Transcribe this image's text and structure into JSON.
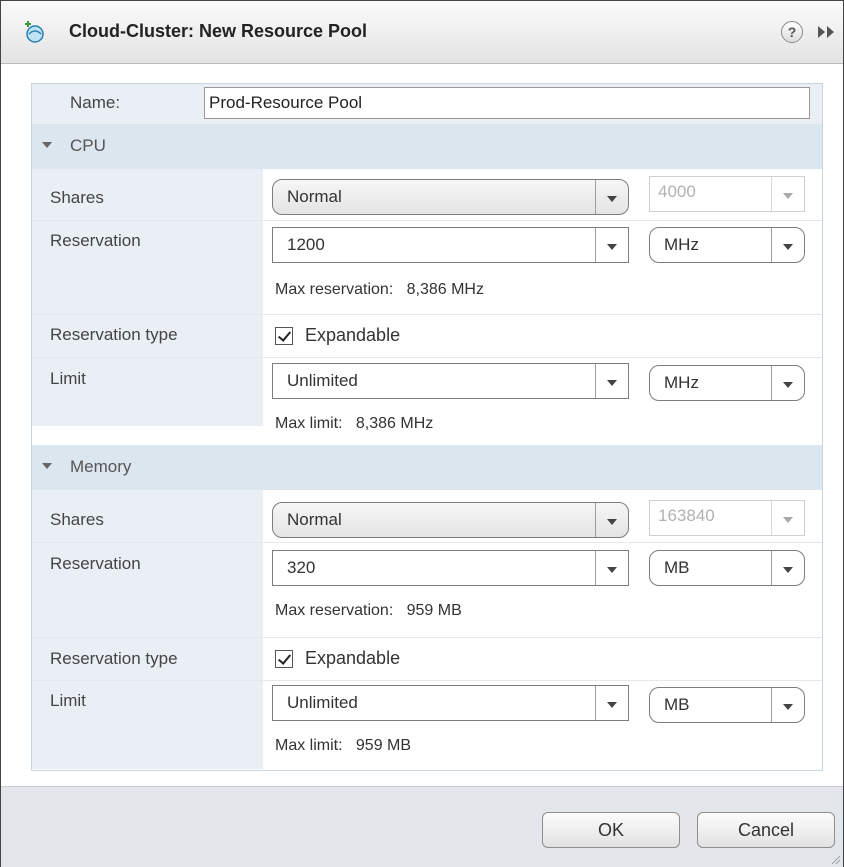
{
  "window": {
    "title": "Cloud-Cluster: New Resource Pool",
    "help_glyph": "?"
  },
  "name_field": {
    "label": "Name:",
    "value": "Prod-Resource Pool"
  },
  "cpu": {
    "header": "CPU",
    "shares": {
      "label": "Shares",
      "level": "Normal",
      "value": "4000"
    },
    "reservation": {
      "label": "Reservation",
      "value": "1200",
      "unit": "MHz",
      "max_label": "Max reservation:",
      "max_value": "8,386 MHz"
    },
    "reservation_type": {
      "label": "Reservation type",
      "checkbox_label": "Expandable",
      "checked": true
    },
    "limit": {
      "label": "Limit",
      "value": "Unlimited",
      "unit": "MHz",
      "max_label": "Max limit:",
      "max_value": "8,386 MHz"
    }
  },
  "memory": {
    "header": "Memory",
    "shares": {
      "label": "Shares",
      "level": "Normal",
      "value": "163840"
    },
    "reservation": {
      "label": "Reservation",
      "value": "320",
      "unit": "MB",
      "max_label": "Max reservation:",
      "max_value": "959 MB"
    },
    "reservation_type": {
      "label": "Reservation type",
      "checkbox_label": "Expandable",
      "checked": true
    },
    "limit": {
      "label": "Limit",
      "value": "Unlimited",
      "unit": "MB",
      "max_label": "Max limit:",
      "max_value": "959 MB"
    }
  },
  "footer": {
    "ok_label": "OK",
    "cancel_label": "Cancel"
  },
  "colors": {
    "label_column": "#e9eff5",
    "section_header": "#dbe6ef",
    "footer": "#e3e7ec"
  }
}
